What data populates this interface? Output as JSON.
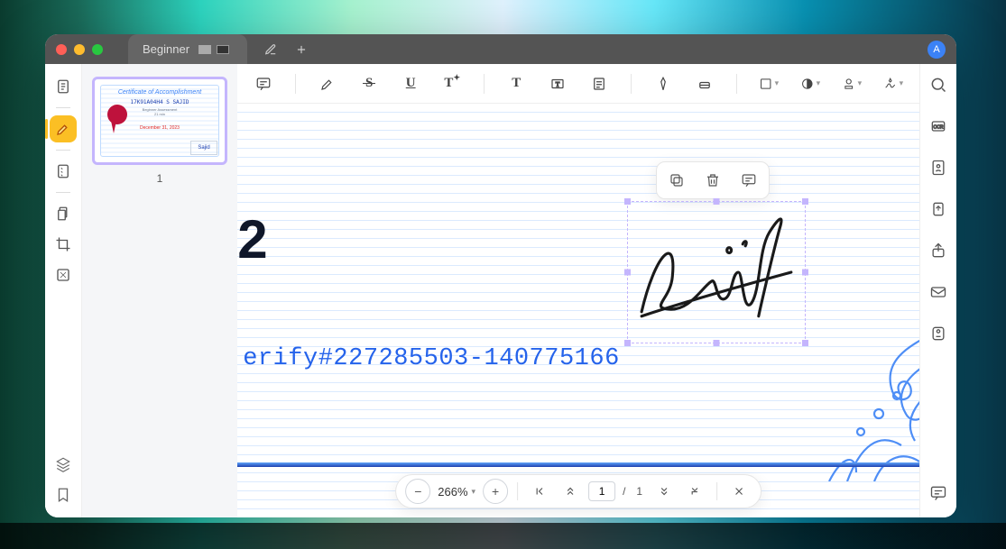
{
  "titlebar": {
    "tab_label": "Beginner",
    "avatar_initial": "A"
  },
  "left_rail": {
    "items": [
      "document",
      "highlight",
      "notes",
      "page",
      "crop",
      "scale"
    ],
    "bottom": [
      "layers",
      "bookmark"
    ]
  },
  "thumbs": {
    "page_number": "1",
    "certificate": {
      "title": "Certificate of Accomplishment",
      "name": "17K91A04H4 S SAJID",
      "sub1": "Beginner Assessment",
      "sub2": "21 min",
      "date": "December 31, 2023",
      "sig_preview": "Sajid"
    }
  },
  "toolbar": {
    "items": [
      "comment",
      "highlighter",
      "strikethrough",
      "underline",
      "text-style",
      "insert-text",
      "text-box",
      "note",
      "pen",
      "eraser",
      "shape",
      "opacity",
      "stamp",
      "signature"
    ]
  },
  "canvas": {
    "big_digit": "2",
    "verify_text": "erify#227285503-140775166",
    "signature_name": "Sajid",
    "floating_toolbar": [
      "copy",
      "delete",
      "comment"
    ]
  },
  "bottombar": {
    "zoom": "266%",
    "page_current": "1",
    "page_total": "1",
    "page_sep": "/"
  },
  "right_rail": {
    "items": [
      "search",
      "ocr",
      "ai",
      "export",
      "share",
      "mail",
      "storage"
    ],
    "bottom": "annotations"
  }
}
